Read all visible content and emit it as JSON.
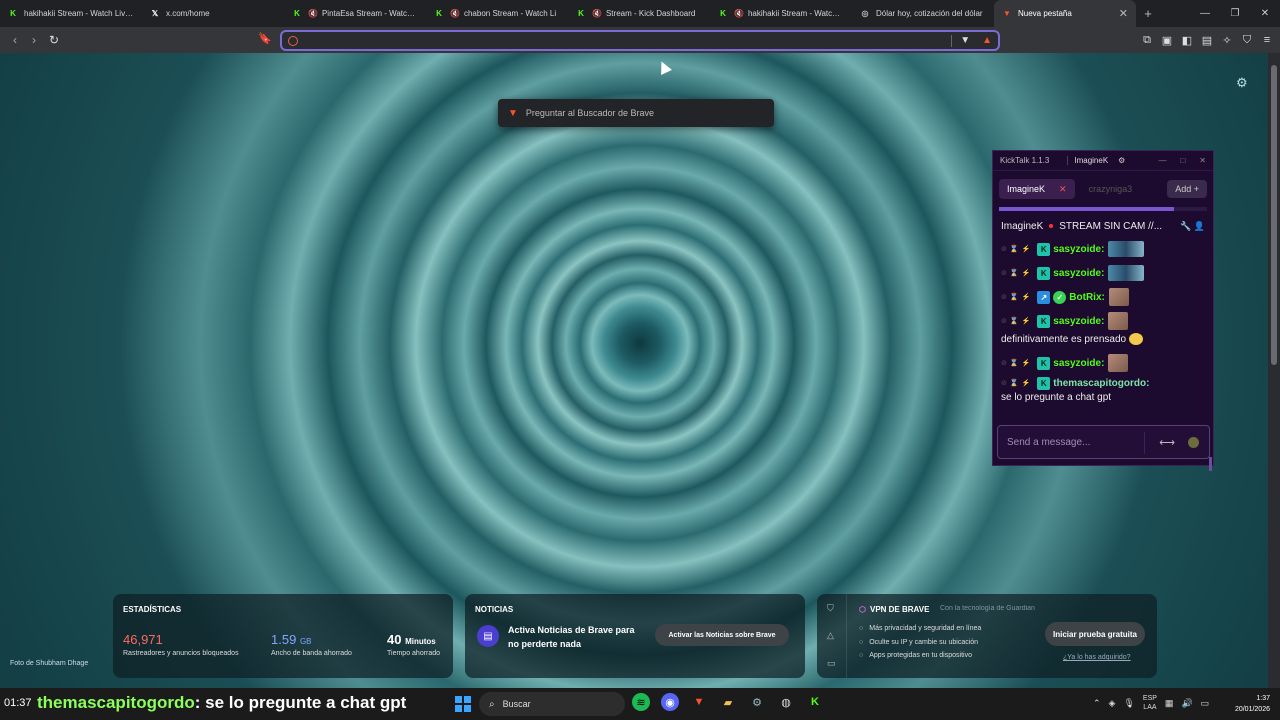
{
  "tabs": [
    {
      "icon": "kick-icon",
      "title": "hakihakii Stream - Watch Live o",
      "muted": false
    },
    {
      "icon": "x-icon",
      "title": "x.com/home",
      "muted": false
    },
    {
      "icon": "kick-icon",
      "title": "PintaEsa Stream - Watch Li",
      "muted": true
    },
    {
      "icon": "kick-icon",
      "title": "chabon Stream - Watch Li",
      "muted": true
    },
    {
      "icon": "kick-icon",
      "title": "Stream - Kick Dashboard",
      "muted": true
    },
    {
      "icon": "kick-icon",
      "title": "hakihakii Stream - Watch Li",
      "muted": true
    },
    {
      "icon": "generic-icon",
      "title": "Dólar hoy, cotización del dólar",
      "muted": false
    },
    {
      "icon": "brave-icon",
      "title": "Nueva pestaña",
      "muted": false,
      "active": true
    }
  ],
  "omnibox": {
    "value": "",
    "placeholder": ""
  },
  "suggestion": {
    "text": "Preguntar al Buscador de Brave"
  },
  "photo_credit": "Foto de Shubham Dhage",
  "kicktalk": {
    "version": "KickTalk 1.1.3",
    "user": "ImagineK",
    "chatrooms": [
      {
        "label": "ImagineK",
        "active": true
      },
      {
        "label": "crazyniga3",
        "active": false
      }
    ],
    "add_label": "Add",
    "stream_title_user": "ImagineK",
    "stream_title": "STREAM SIN CAM //...",
    "messages": [
      {
        "badge": "sub",
        "user": "sasyzoide:",
        "color": "#53fc18",
        "emote": "wide"
      },
      {
        "badge": "sub",
        "user": "sasyzoide:",
        "color": "#53fc18",
        "emote": "wide"
      },
      {
        "badge": "bot",
        "user": "BotRix:",
        "color": "#53fc18",
        "emote": "small"
      },
      {
        "badge": "sub",
        "user": "sasyzoide:",
        "color": "#53fc18",
        "emote": "small"
      },
      {
        "text_only": "definitivamente es prensado"
      },
      {
        "badge": "sub",
        "user": "sasyzoide:",
        "color": "#53fc18",
        "emote": "small"
      },
      {
        "badge": "sub",
        "user": "themascapitogordo:",
        "color": "#7ee3a8",
        "text": "se lo pregunte a chat gpt"
      }
    ],
    "input_placeholder": "Send a message..."
  },
  "stats": {
    "title": "ESTADÍSTICAS",
    "trackers_value": "46,971",
    "trackers_label": "Rastreadores y anuncios bloqueados",
    "bandwidth_value": "1.59",
    "bandwidth_unit": "GB",
    "bandwidth_label": "Ancho de banda ahorrado",
    "time_value": "40",
    "time_unit": "Minutos",
    "time_label": "Tiempo ahorrado"
  },
  "news": {
    "title": "NOTICIAS",
    "text": "Activa Noticias de Brave para no perderte nada",
    "button": "Activar las Noticias sobre Brave"
  },
  "vpn": {
    "title": "VPN DE BRAVE",
    "powered": "Con la tecnología de Guardian",
    "features": [
      "Más privacidad y seguridad en línea",
      "Oculte su IP y cambie su ubicación",
      "Apps protegidas en tu dispositivo"
    ],
    "button": "Iniciar prueba gratuita",
    "link": "¿Ya lo has adquirido?"
  },
  "taskbar": {
    "left_time": "01:37",
    "chat_user": "themascapitogordo",
    "chat_text": ": se lo pregunte a chat gpt",
    "search_label": "Buscar",
    "lang_line1": "ESP",
    "lang_line2": "LAA",
    "clock_time": "1:37",
    "clock_date": "20/01/2026"
  },
  "colors": {
    "kick_green": "#53fc18",
    "brave_orange": "#fb542b",
    "omnibox_border": "#7c6bd6",
    "kicktalk_bg": "#1c0b2e"
  }
}
